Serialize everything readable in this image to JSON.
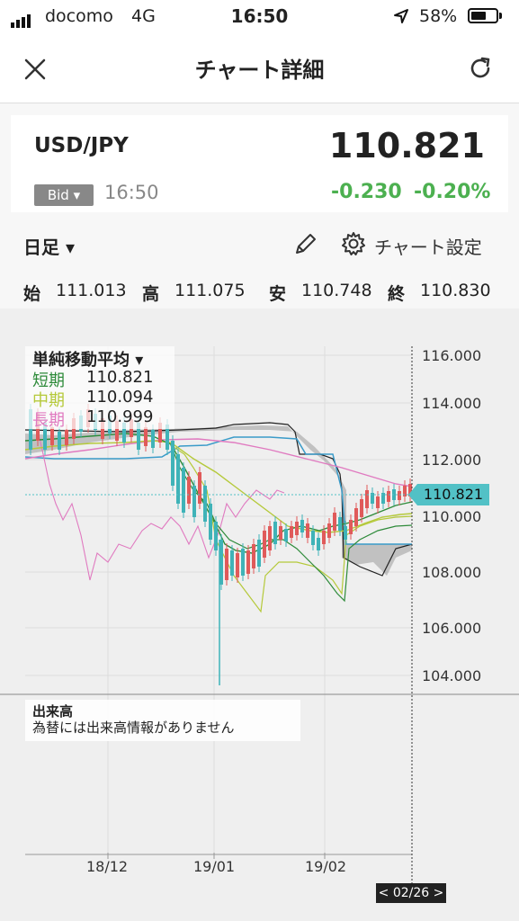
{
  "status_bar": {
    "carrier": "docomo",
    "network": "4G",
    "time": "16:50",
    "battery": "58%"
  },
  "nav": {
    "title": "チャート詳細"
  },
  "quote": {
    "pair": "USD/JPY",
    "price": "110.821",
    "bid_label": "Bid",
    "time": "16:50",
    "change": "-0.230",
    "change_pct": "-0.20%",
    "change_color": "#4cb050"
  },
  "toolbar": {
    "period": "日足",
    "settings_label": "チャート設定"
  },
  "ohlc": {
    "open_label": "始",
    "open": "111.013",
    "high_label": "高",
    "high": "111.075",
    "low_label": "安",
    "low": "110.748",
    "close_label": "終",
    "close": "110.830"
  },
  "indicator": {
    "title": "単純移動平均",
    "short_label": "短期",
    "short_value": "110.821",
    "mid_label": "中期",
    "mid_value": "110.094",
    "long_label": "長期",
    "long_value": "110.999"
  },
  "volume": {
    "title": "出来高",
    "message": "為替には出来高情報がありません"
  },
  "chart_data": {
    "type": "line",
    "title": "",
    "y_ticks": [
      "116.000",
      "114.000",
      "112.000",
      "110.000",
      "108.000",
      "106.000",
      "104.000"
    ],
    "ylim": [
      103.6,
      117.0
    ],
    "x_ticks": [
      "18/12",
      "19/01",
      "19/02"
    ],
    "current_price_label": "110.821",
    "cursor_date_label": "< 02/26 >",
    "series": [
      {
        "name": "短期",
        "color": "#2e8b3a"
      },
      {
        "name": "中期",
        "color": "#b5c93a"
      },
      {
        "name": "長期",
        "color": "#e07ac0"
      }
    ]
  }
}
